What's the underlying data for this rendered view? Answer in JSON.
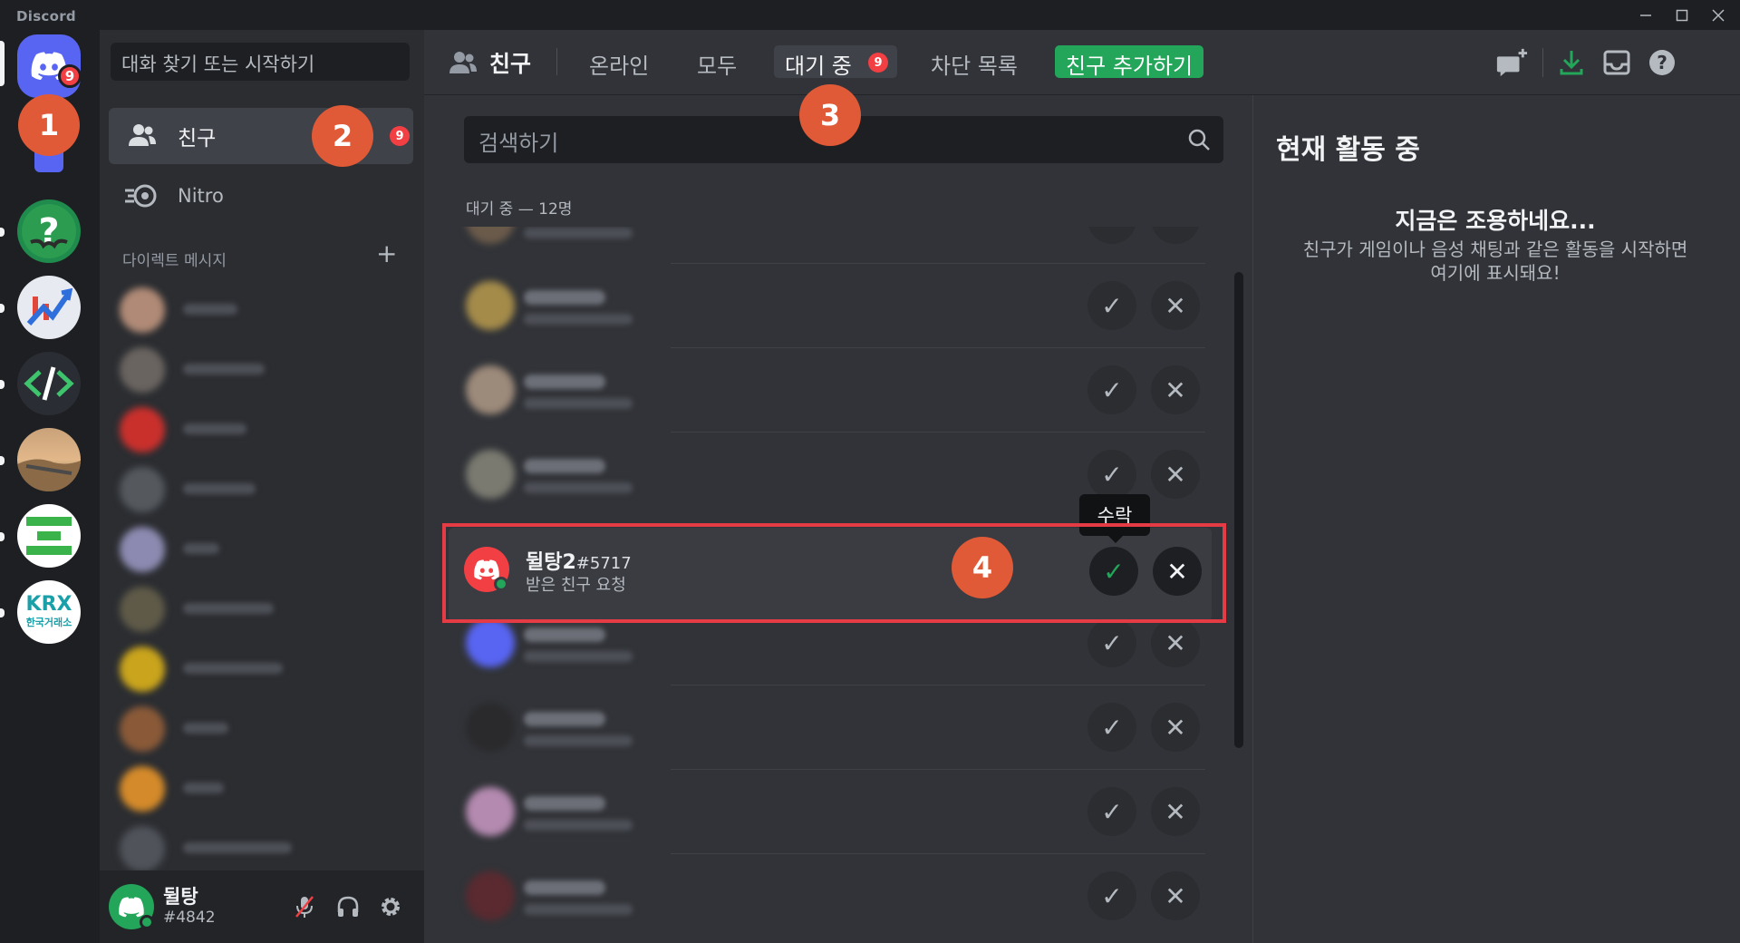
{
  "app": {
    "title": "Discord"
  },
  "rail": {
    "home_badge": "9",
    "servers": [
      "help-server",
      "chart-server",
      "dev-server",
      "desert-server",
      "green-server",
      "krx-server"
    ],
    "krx_label_top": "KRX",
    "krx_label_bottom": "한국거래소"
  },
  "sidebar": {
    "search_placeholder": "대화 찾기 또는 시작하기",
    "friends_label": "친구",
    "friends_badge": "9",
    "nitro_label": "Nitro",
    "dm_header": "다이렉트 메시지",
    "dm_add": "+"
  },
  "user": {
    "name": "뒬탕",
    "tag": "#4842"
  },
  "header": {
    "friends_title": "친구",
    "tabs": {
      "online": "온라인",
      "all": "모두",
      "pending": "대기 중",
      "blocked": "차단 목록",
      "add_friend": "친구 추가하기"
    },
    "pending_badge": "9"
  },
  "main": {
    "search_placeholder": "검색하기",
    "section_label": "대기 중 — 12명",
    "highlighted": {
      "name": "뒬탕2",
      "tag": "#5717",
      "subtitle": "받은 친구 요청"
    },
    "tooltip": "수락"
  },
  "activity": {
    "title": "현재 활동 중",
    "empty_heading": "지금은 조용하네요...",
    "empty_body": "친구가 게임이나 음성 채팅과 같은 활동을 시작하면 여기에 표시돼요!"
  },
  "markers": [
    "1",
    "2",
    "3",
    "4"
  ],
  "colors": {
    "accent": "#5865f2",
    "green": "#23a55a",
    "red": "#f23f43",
    "marker": "#e05a37"
  }
}
